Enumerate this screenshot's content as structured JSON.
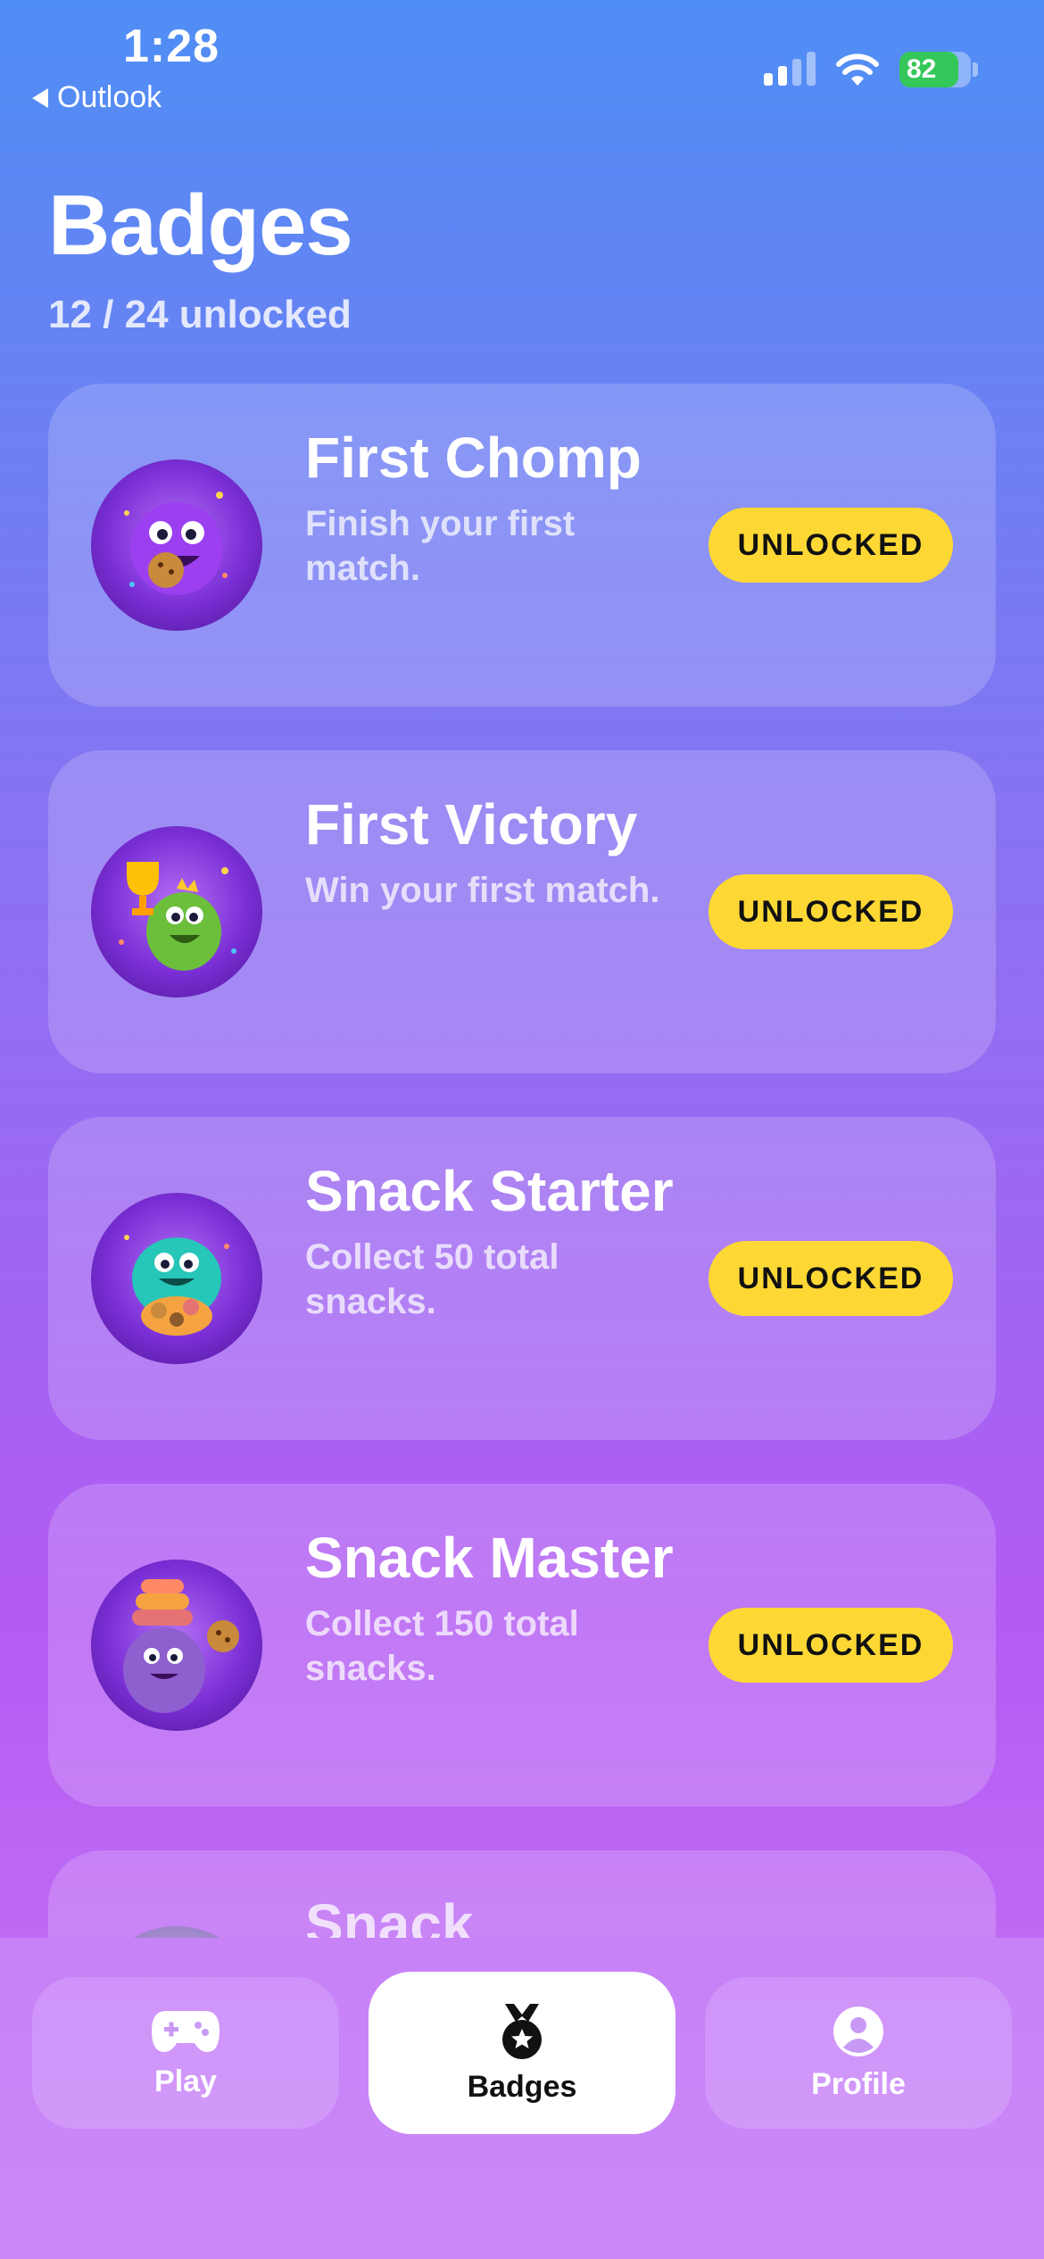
{
  "status_bar": {
    "time": "1:28",
    "back_app": "Outlook",
    "battery_level": 82,
    "battery_text": "82",
    "battery_color": "#34c759"
  },
  "header": {
    "title": "Badges",
    "unlock_count": "12 / 24 unlocked"
  },
  "badges": [
    {
      "name": "First Chomp",
      "description": "Finish your first match.",
      "status": "UNLOCKED",
      "icon": "purple-monster-eating-cookie-icon"
    },
    {
      "name": "First Victory",
      "description": "Win your first match.",
      "status": "UNLOCKED",
      "icon": "green-monster-trophy-icon"
    },
    {
      "name": "Snack Starter",
      "description": "Collect 50 total snacks.",
      "status": "UNLOCKED",
      "icon": "teal-monster-snack-pile-icon"
    },
    {
      "name": "Snack Master",
      "description": "Collect 150 total snacks.",
      "status": "UNLOCKED",
      "icon": "purple-monster-snack-tower-icon"
    },
    {
      "name": "Snack",
      "description": "",
      "status": "",
      "icon": "monster-badge-icon"
    }
  ],
  "tab_bar": {
    "tabs": [
      {
        "label": "Play",
        "icon": "gamepad-icon",
        "active": false
      },
      {
        "label": "Badges",
        "icon": "medal-icon",
        "active": true
      },
      {
        "label": "Profile",
        "icon": "person-circle-icon",
        "active": false
      }
    ]
  },
  "colors": {
    "pill": "#fdd835",
    "background_top": "#4f8ef5",
    "background_bottom": "#c879f6"
  }
}
